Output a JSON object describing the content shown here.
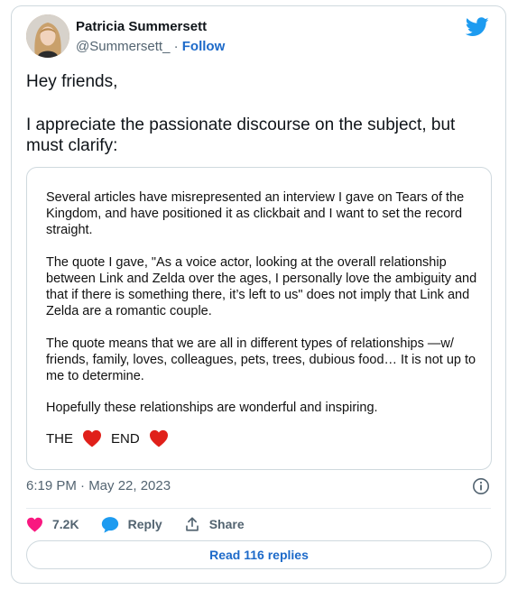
{
  "author": {
    "name": "Patricia Summersett",
    "handle": "@Summersett_",
    "separator": "·",
    "follow_label": "Follow"
  },
  "tweet": {
    "line1": "Hey friends,",
    "line2": "I appreciate the passionate discourse on the subject, but must clarify:"
  },
  "statement": {
    "paragraph1": "Several articles have misrepresented an interview I gave on Tears of the Kingdom, and have positioned it as clickbait and I want to set the record straight.",
    "paragraph2": "The quote I gave, \"As a voice actor, looking at the overall relationship between Link and Zelda over the ages, I personally love the ambiguity and that if there is something there, it’s left to us\" does not imply that Link and Zelda are a romantic couple.",
    "paragraph3": "The quote means that we are all in different types of relationships —w/ friends, family, loves, colleagues, pets, trees, dubious food… It is not up to me to determine.",
    "paragraph4": "Hopefully these relationships are wonderful and inspiring.",
    "the": "THE",
    "end": "END"
  },
  "meta": {
    "timestamp": "6:19 PM · May 22, 2023"
  },
  "actions": {
    "likes": "7.2K",
    "reply_label": "Reply",
    "share_label": "Share"
  },
  "replies_button": "Read 116 replies",
  "colors": {
    "accent": "#1d6ac9",
    "twitter_blue": "#1d9bf0",
    "like_pink": "#f91880",
    "heart_red": "#e0201a"
  }
}
